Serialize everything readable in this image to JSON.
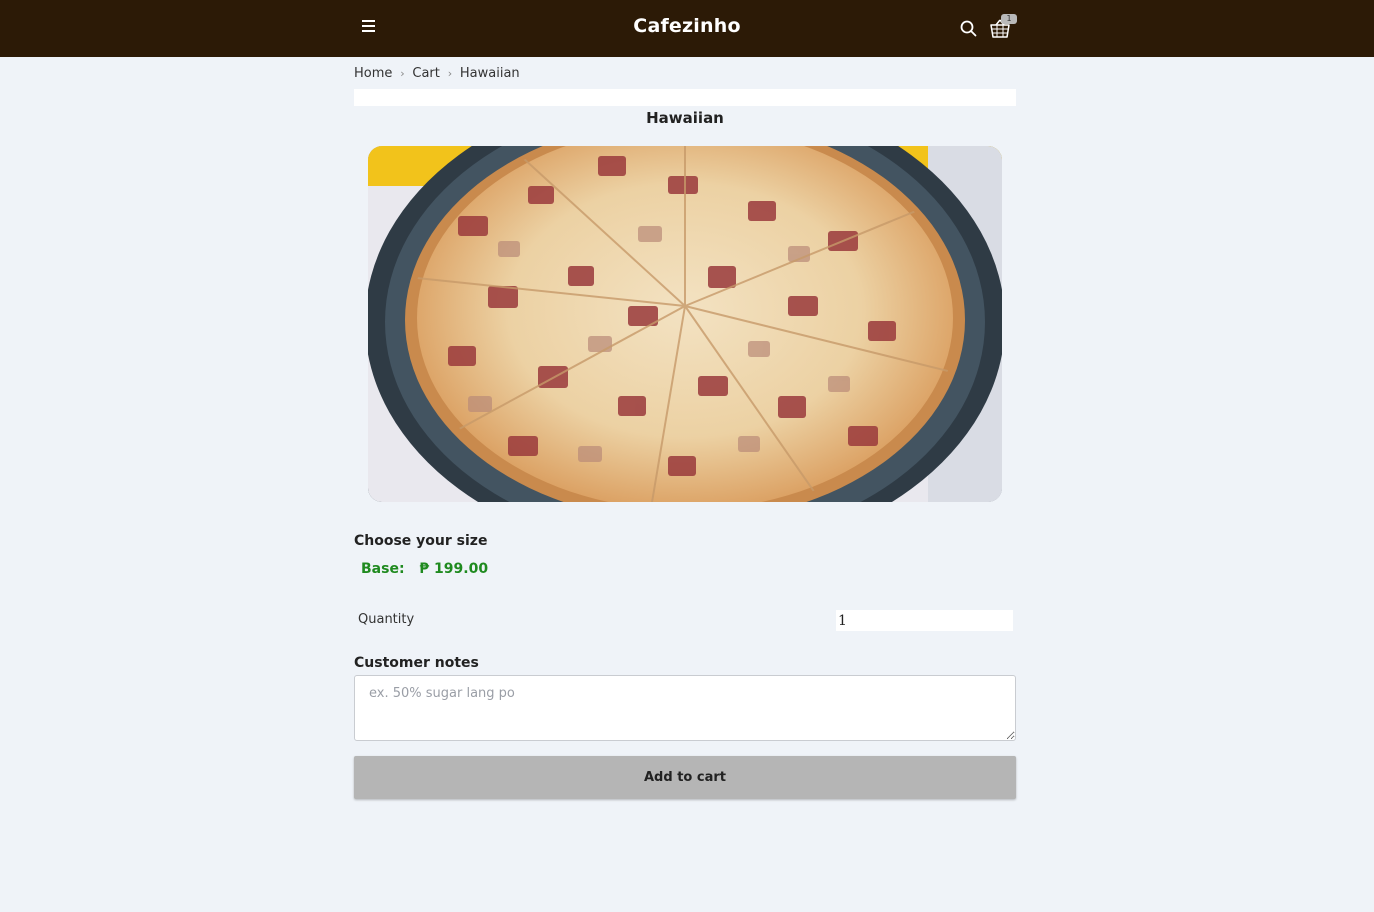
{
  "header": {
    "brand": "Cafezinho",
    "cart_count": "1",
    "background_color": "#2c1a06"
  },
  "breadcrumb": {
    "items": [
      "Home",
      "Cart",
      "Hawaiian"
    ]
  },
  "product": {
    "title": "Hawaiian",
    "image_label": "pizza"
  },
  "size": {
    "heading": "Choose your size",
    "option_label": "Base:",
    "option_price": "₱ 199.00",
    "accent_color": "#1f8a1f"
  },
  "quantity": {
    "label": "Quantity",
    "value": "1"
  },
  "notes": {
    "heading": "Customer notes",
    "placeholder": "ex. 50% sugar lang po"
  },
  "actions": {
    "add_to_cart_label": "Add to cart"
  },
  "icons": {
    "menu": "menu-icon",
    "search": "search-icon",
    "cart": "basket-icon",
    "chevron": "chevron-right-icon"
  }
}
